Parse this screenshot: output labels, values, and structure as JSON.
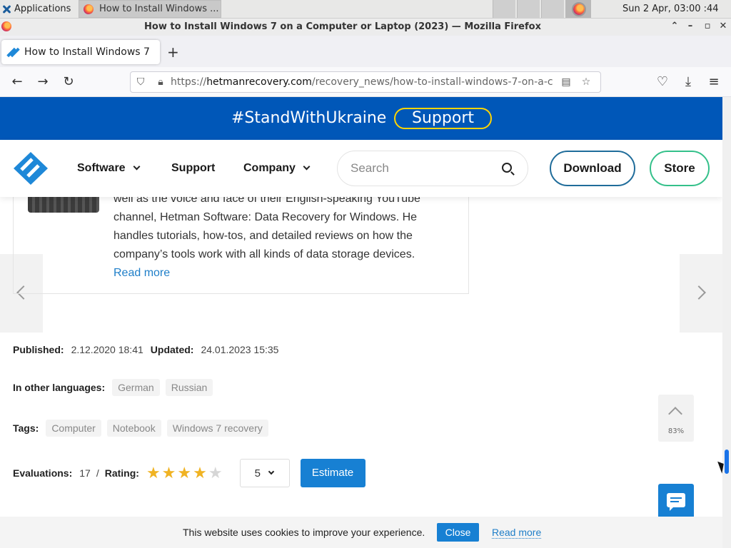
{
  "os": {
    "apps_label": "Applications",
    "task_label": "How to Install Windows ...",
    "clock": "Sun  2 Apr, 03:00  :44"
  },
  "browser": {
    "window_title": "How to Install Windows 7 on a Computer or Laptop (2023) — Mozilla Firefox",
    "tab_title": "How to Install Windows 7",
    "url_domain": "hetmanrecovery.com",
    "url_prefix": "https://",
    "url_path": "/recovery_news/how-to-install-windows-7-on-a-c"
  },
  "banner": {
    "hashtag": "#StandWithUkraine",
    "support": "Support"
  },
  "header": {
    "nav": [
      "Software",
      "Support",
      "Company"
    ],
    "search_placeholder": "Search",
    "download": "Download",
    "store": "Store"
  },
  "author": {
    "line1": "well as the voice and face of their English-speaking YouTube",
    "line2": "channel, Hetman Software: Data Recovery for Windows. He",
    "line3": "handles tutorials, how-tos, and detailed reviews on how the",
    "line4": "company’s tools work with all kinds of data storage devices.",
    "read_more": "Read more"
  },
  "meta": {
    "published_label": "Published:",
    "published": "2.12.2020 18:41",
    "updated_label": "Updated:",
    "updated": "24.01.2023 15:35",
    "languages_label": "In other languages:",
    "languages": [
      "German",
      "Russian"
    ],
    "tags_label": "Tags:",
    "tags": [
      "Computer",
      "Notebook",
      "Windows 7 recovery"
    ],
    "evaluations_label": "Evaluations:",
    "evaluations": "17",
    "separator": "/",
    "rating_label": "Rating:",
    "rating_value": 4,
    "rating_max": 5,
    "select_value": "5",
    "estimate": "Estimate"
  },
  "scroll_top": {
    "percent": "83%"
  },
  "cookie": {
    "text": "This website uses cookies to improve your experience.",
    "close": "Close",
    "read_more": "Read more"
  },
  "colors": {
    "banner_blue": "#0057b8",
    "banner_yellow": "#ffd500",
    "accent_blue": "#1780d3",
    "star_gold": "#f0b323",
    "store_green": "#34c08a"
  }
}
